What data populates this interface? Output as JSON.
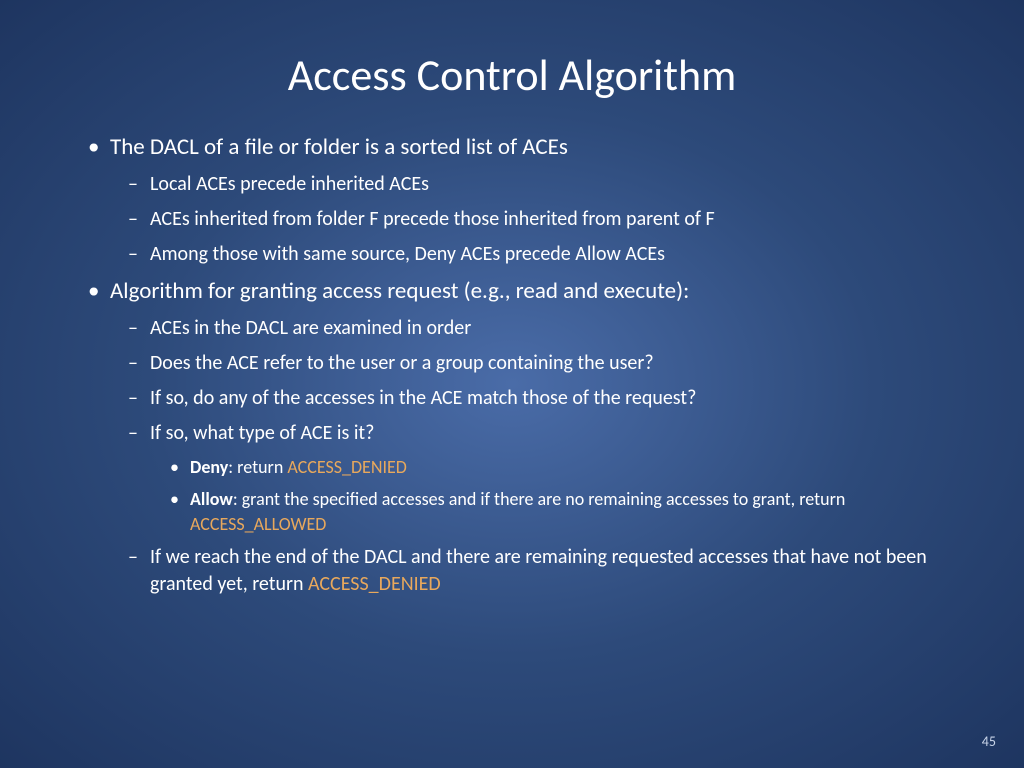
{
  "title": "Access Control Algorithm",
  "page_number": "45",
  "accent_color": "#e8a85c",
  "b1_text": "The DACL of a file or folder is a sorted list of ACEs",
  "b1_1": "Local ACEs precede inherited ACEs",
  "b1_2": "ACEs inherited from folder F precede those inherited from parent of F",
  "b1_3": "Among those with same source, Deny ACEs precede Allow ACEs",
  "b2_text": "Algorithm for granting access request (e.g., read and execute):",
  "b2_1": "ACEs in the DACL are examined in order",
  "b2_2": "Does the ACE refer to the user or a group containing the user?",
  "b2_3": "If so, do any of the accesses in the ACE match those of the request?",
  "b2_4": "If so, what type of ACE is it?",
  "b2_4_1_bold": "Deny",
  "b2_4_1_text": ": return ",
  "b2_4_1_acc": "ACCESS_DENIED",
  "b2_4_2_bold": "Allow",
  "b2_4_2_text": ": grant the specified accesses and if there are no remaining accesses to grant, return ",
  "b2_4_2_acc": "ACCESS_ALLOWED",
  "b2_5_text": "If we reach the end of the DACL and there are remaining requested accesses that have not been granted yet, return ",
  "b2_5_acc": "ACCESS_DENIED"
}
